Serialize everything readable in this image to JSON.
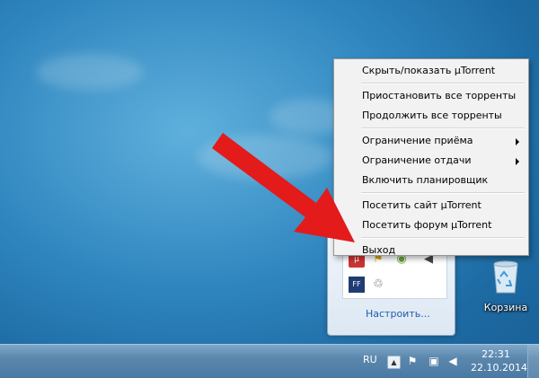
{
  "menu": {
    "items": [
      {
        "label": "Скрыть/показать µTorrent",
        "submenu": false
      },
      {
        "sep": true
      },
      {
        "label": "Приостановить все торренты",
        "submenu": false
      },
      {
        "label": "Продолжить все торренты",
        "submenu": false
      },
      {
        "sep": true
      },
      {
        "label": "Ограничение приёма",
        "submenu": true
      },
      {
        "label": "Ограничение отдачи",
        "submenu": true
      },
      {
        "label": "Включить планировщик",
        "submenu": false
      },
      {
        "sep": true
      },
      {
        "label": "Посетить сайт µTorrent",
        "submenu": false
      },
      {
        "label": "Посетить форум µTorrent",
        "submenu": false
      },
      {
        "sep": true
      },
      {
        "label": "Выход",
        "submenu": false
      }
    ]
  },
  "tray_panel": {
    "customize_label": "Настроить...",
    "icons": [
      "utorrent-icon",
      "flag-icon",
      "shield-icon",
      "speaker-icon",
      "ff-icon",
      "recycle-icon"
    ]
  },
  "desktop": {
    "recycle_bin_label": "Корзина"
  },
  "taskbar": {
    "language": "RU",
    "time": "22:31",
    "date": "22.10.2014"
  },
  "colors": {
    "arrow": "#e31b1b",
    "link": "#1e5ea8"
  }
}
